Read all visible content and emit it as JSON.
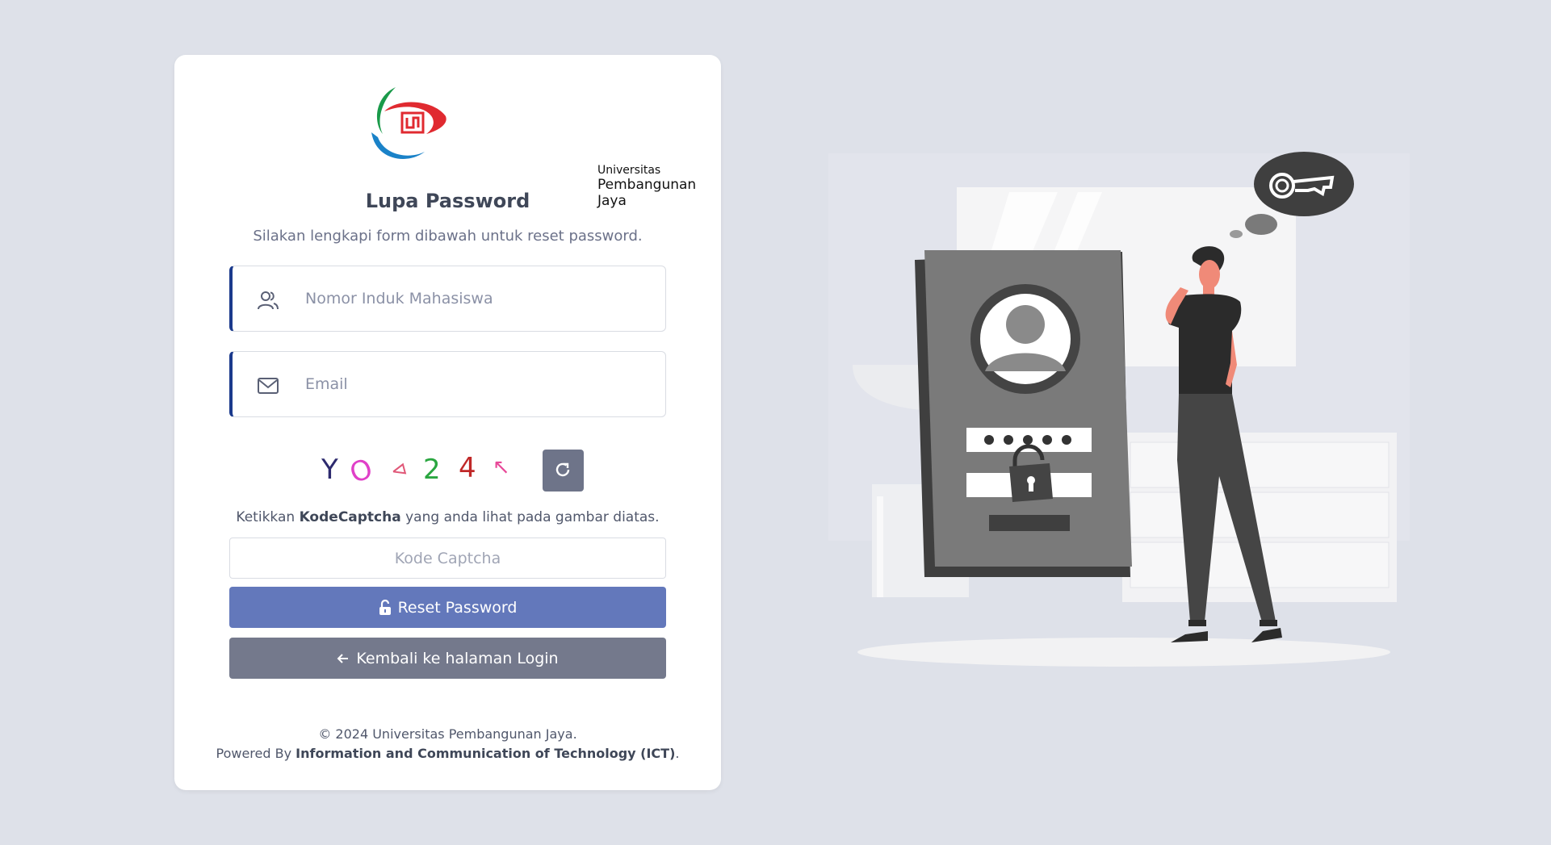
{
  "logo": {
    "line1": "Universitas",
    "line2": "Pembangunan Jaya"
  },
  "form": {
    "title": "Lupa Password",
    "subtitle": "Silakan lengkapi form dibawah untuk reset password.",
    "nim_placeholder": "Nomor Induk Mahasiswa",
    "email_placeholder": "Email",
    "captcha_chars": [
      "Y",
      "O",
      "⊲",
      "2",
      "4",
      "↖"
    ],
    "captcha_hint_pre": "Ketikkan ",
    "captcha_hint_bold": "KodeCaptcha",
    "captcha_hint_post": " yang anda lihat pada gambar diatas.",
    "captcha_placeholder": "Kode Captcha",
    "reset_label": "Reset Password",
    "back_label": "Kembali ke halaman Login"
  },
  "footer": {
    "copyright": "© 2024 Universitas Pembangunan Jaya.",
    "powered_pre": "Powered By ",
    "powered_bold": "Information and Communication of Technology (ICT)",
    "powered_post": "."
  },
  "colors": {
    "background": "#dee1e9",
    "accent_border": "#1b3a8c",
    "reset_button": "#6378bb",
    "back_button": "#74798c"
  },
  "icons": {
    "nim": "users-icon",
    "email": "envelope-icon",
    "refresh": "refresh-icon",
    "reset": "unlock-icon",
    "back": "arrow-left-icon"
  }
}
